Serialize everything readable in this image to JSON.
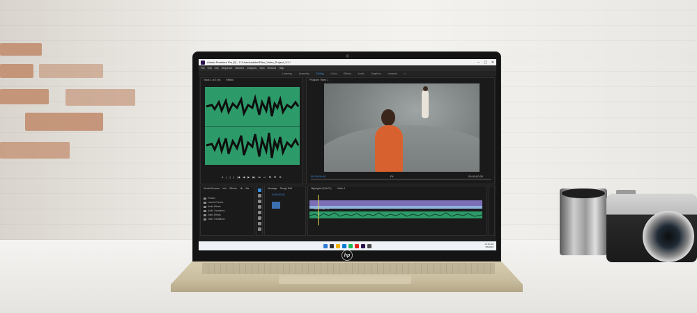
{
  "window": {
    "title": "Adobe Premiere Pro (2) - C:\\Users\\adobe\\Files_Video_Project_V1 *",
    "controls": [
      "–",
      "▢",
      "✕"
    ]
  },
  "menu": [
    "File",
    "Edit",
    "Clip",
    "Sequence",
    "Markers",
    "Graphics",
    "View",
    "Window",
    "Help"
  ],
  "workspaces": {
    "items": [
      "Learning",
      "Assembly",
      "Editing",
      "Color",
      "Effects",
      "Audio",
      "Graphics",
      "Libraries",
      "»"
    ],
    "active": "Editing"
  },
  "source_panel": {
    "tabs": [
      "Track 1 of 2 (fx)",
      "Effects"
    ],
    "transport": [
      "▾",
      "|",
      "{",
      "}",
      "|◀",
      "◀",
      "▶",
      "▶|",
      "⇆",
      "▭",
      "⊞",
      "⊡",
      "⊕"
    ]
  },
  "program_panel": {
    "tabs": [
      "Program: Video 1"
    ],
    "timecode_left": "00:00:00:00",
    "fit": "Fit",
    "timecode_right": "00:00:00:30",
    "transport": [
      "▾",
      "|",
      "{",
      "}",
      "|◀",
      "◀",
      "▶",
      "▶|",
      "⇆",
      "▭",
      "⊞",
      "⊡",
      "⊕"
    ]
  },
  "project_panel": {
    "tabs": [
      "Media Browser",
      "Info",
      "Effects",
      "Lib",
      "Ma"
    ],
    "items": [
      "Presets",
      "Lumetri Presets",
      "Audio Effects",
      "Audio Transitions",
      "Video Effects",
      "Video Transitions"
    ]
  },
  "montage_panel": {
    "tabs": [
      "Montage",
      "Rough Edit"
    ],
    "timecode": "00:00:00:00"
  },
  "timeline_panel": {
    "tabs": [
      "Highlights (Edit 01)",
      "Video 1"
    ],
    "clip_label": "Video Project V1"
  },
  "taskbar": {
    "time": "10:15 AM",
    "date": "9/6/2022",
    "icon_colors": [
      "#2f7bd6",
      "#333333",
      "#f0b400",
      "#0078d4",
      "#1db954",
      "#e2231a",
      "#2a0f4a",
      "#4a4a4a"
    ]
  },
  "brand": "hp"
}
